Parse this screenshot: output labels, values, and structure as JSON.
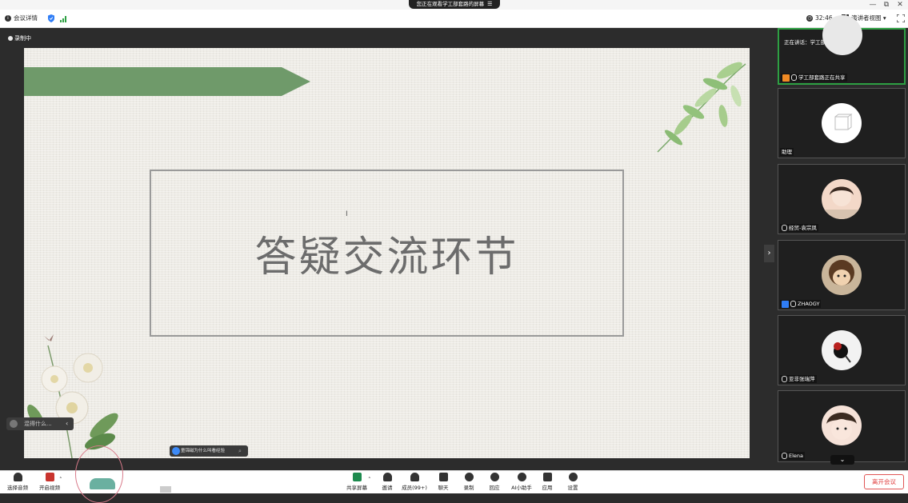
{
  "window": {
    "share_banner": "您正在观看学工部套路的屏幕",
    "controls": [
      "—",
      "⧉",
      "✕"
    ]
  },
  "infobar": {
    "meeting_info": "会议详情",
    "timer": "32:46",
    "view_mode": "演讲者视图"
  },
  "stage": {
    "recording": "录制中",
    "slide_title": "答疑交流环节",
    "chat_preview": "混得什么...",
    "ai_prompt": "童锦磁为什么叫看经验",
    "cursor": "I"
  },
  "panel": {
    "speaking_label": "正在讲话：学工部套路;",
    "participants": [
      {
        "name": "学工部套路正在共享"
      },
      {
        "name": "助理"
      },
      {
        "name": "经贸-袁宗凤"
      },
      {
        "name": "ZHAOGY"
      },
      {
        "name": "亚非张瑞萍"
      },
      {
        "name": "Elena"
      }
    ]
  },
  "toolbar": {
    "items": [
      {
        "label": "选择音频"
      },
      {
        "label": "开启视频"
      },
      {
        "label": "共享屏幕"
      },
      {
        "label": "邀请"
      },
      {
        "label": "成员(99+)"
      },
      {
        "label": "聊天"
      },
      {
        "label": "录制"
      },
      {
        "label": "回应"
      },
      {
        "label": "AI小助手"
      },
      {
        "label": "应用"
      },
      {
        "label": "设置"
      }
    ],
    "leave": "离开会议"
  },
  "colors": {
    "accent_green": "#2ea043",
    "leave_red": "#e04040",
    "slide_bg": "#eeece6"
  }
}
